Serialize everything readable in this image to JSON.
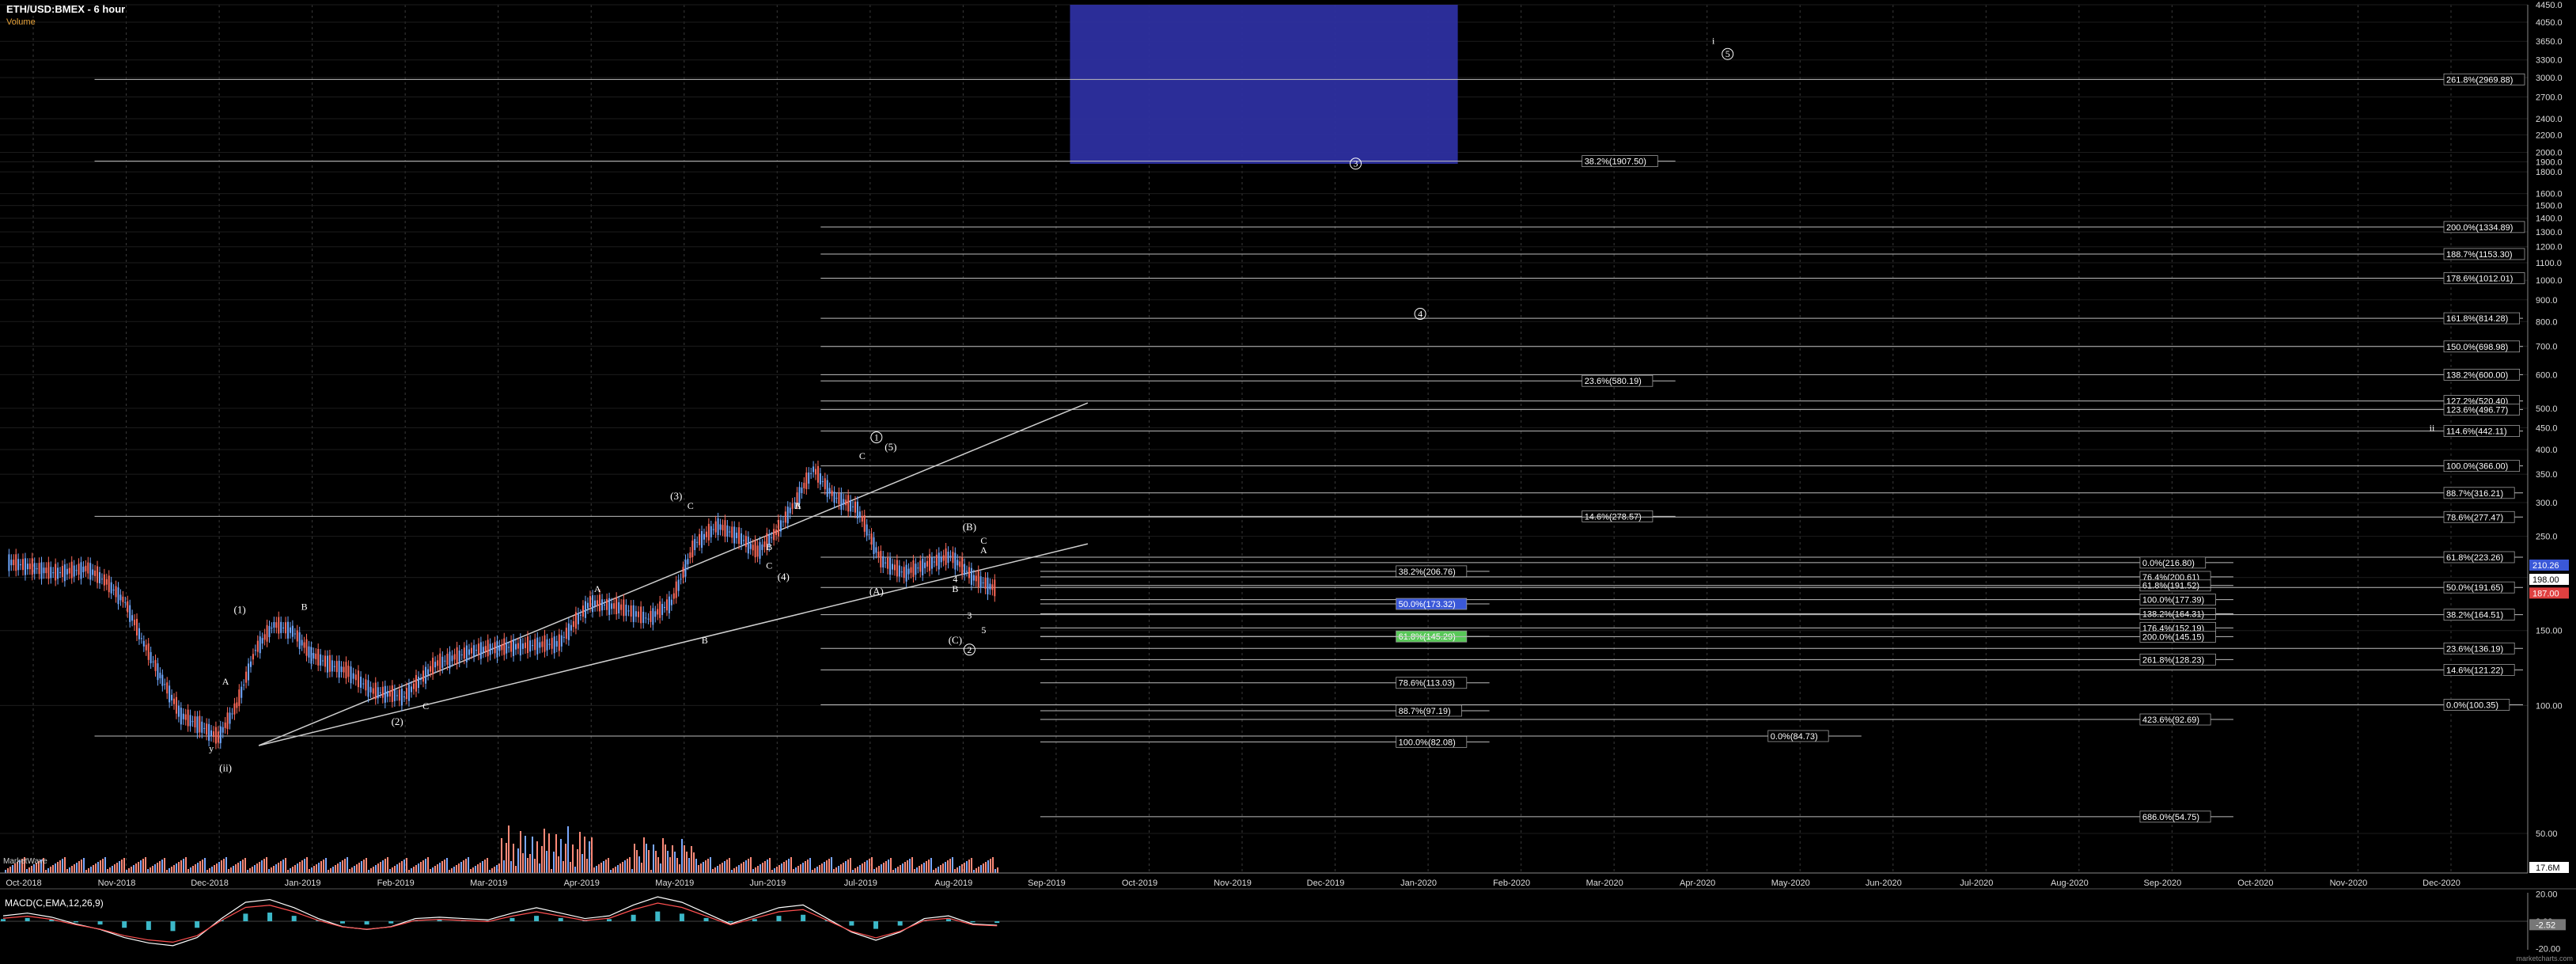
{
  "header": {
    "title": "ETH/USD:BMEX - 6 hour",
    "subtitle": "Volume",
    "macd_label": "MACD(C,EMA,12,26,9)",
    "watermark": "MarketWave",
    "footer_mark": "marketcharts.com"
  },
  "colors": {
    "background": "#000000",
    "grid": "#3a3a3a",
    "candle_up": "#6fa8ff",
    "candle_down": "#ff6a5a",
    "blue_box": "#2d2fa0",
    "lines": "#cfcfcf"
  },
  "chart_data": {
    "type": "candlestick",
    "y_scale": "log",
    "ylim": [
      50,
      4450
    ],
    "x_ticks": [
      "Oct-2018",
      "Nov-2018",
      "Dec-2018",
      "Jan-2019",
      "Feb-2019",
      "Mar-2019",
      "Apr-2019",
      "May-2019",
      "Jun-2019",
      "Jul-2019",
      "Aug-2019",
      "Sep-2019",
      "Oct-2019",
      "Nov-2019",
      "Dec-2019",
      "Jan-2020",
      "Feb-2020",
      "Mar-2020",
      "Apr-2020",
      "May-2020",
      "Jun-2020",
      "Jul-2020",
      "Aug-2020",
      "Sep-2020",
      "Oct-2020",
      "Nov-2020",
      "Dec-2020"
    ],
    "y_ticks": [
      50,
      100,
      150,
      200,
      250,
      300,
      350,
      400,
      450,
      500,
      600,
      700,
      800,
      900,
      1000,
      1100,
      1200,
      1300,
      1400,
      1500,
      1600,
      1800,
      1900,
      2000,
      2200,
      2400,
      2700,
      3000,
      3300,
      3650,
      4050,
      4450
    ],
    "y_tick_labels": [
      "50.00",
      "100.00",
      "150.00",
      "200.0",
      "250.0",
      "300.0",
      "350.0",
      "400.0",
      "450.0",
      "500.0",
      "600.0",
      "700.0",
      "800.0",
      "900.0",
      "1000.0",
      "1100.0",
      "1200.0",
      "1300.0",
      "1400.0",
      "1500.0",
      "1600.0",
      "1800.0",
      "1900.0",
      "2000.0",
      "2200.0",
      "2400.0",
      "2700.0",
      "3000.0",
      "3300.0",
      "3650.0",
      "4050.0",
      "4450.0"
    ],
    "price_path": [
      [
        "Oct-2018",
        218
      ],
      [
        "Oct-2018",
        205
      ],
      [
        "Nov-2018",
        210
      ],
      [
        "Nov-2018",
        195
      ],
      [
        "Nov-2018",
        175
      ],
      [
        "Nov-2018",
        140
      ],
      [
        "Nov-2018",
        115
      ],
      [
        "Dec-2018",
        95
      ],
      [
        "Dec-2018",
        90
      ],
      [
        "Dec-2018",
        84
      ],
      [
        "Dec-2018",
        100
      ],
      [
        "Dec-2018",
        135
      ],
      [
        "Jan-2019",
        155
      ],
      [
        "Jan-2019",
        150
      ],
      [
        "Jan-2019",
        132
      ],
      [
        "Jan-2019",
        125
      ],
      [
        "Jan-2019",
        120
      ],
      [
        "Feb-2019",
        108
      ],
      [
        "Feb-2019",
        105
      ],
      [
        "Feb-2019",
        125
      ],
      [
        "Mar-2019",
        135
      ],
      [
        "Mar-2019",
        138
      ],
      [
        "Apr-2019",
        140
      ],
      [
        "Apr-2019",
        175
      ],
      [
        "Apr-2019",
        170
      ],
      [
        "May-2019",
        160
      ],
      [
        "May-2019",
        175
      ],
      [
        "May-2019",
        240
      ],
      [
        "May-2019",
        265
      ],
      [
        "Jun-2019",
        250
      ],
      [
        "Jun-2019",
        230
      ],
      [
        "Jun-2019",
        255
      ],
      [
        "Jun-2019",
        300
      ],
      [
        "Jun-2019",
        360
      ],
      [
        "Jul-2019",
        310
      ],
      [
        "Jul-2019",
        290
      ],
      [
        "Jul-2019",
        220
      ],
      [
        "Jul-2019",
        205
      ],
      [
        "Aug-2019",
        215
      ],
      [
        "Aug-2019",
        225
      ],
      [
        "Aug-2019",
        200
      ],
      [
        "Aug-2019",
        187
      ]
    ],
    "last_price": "187.00",
    "current_price_labels": [
      {
        "text": "210.26",
        "value": 210.26,
        "color": "#3a58d8"
      },
      {
        "text": "198.00",
        "value": 198,
        "color": "#ffffff"
      },
      {
        "text": "187.00",
        "value": 187,
        "color": "#e04040"
      }
    ],
    "blue_box": {
      "x_from": "Oct-2019",
      "x_to": "Feb-2020",
      "y_from": 1880,
      "y_to": 4450
    },
    "channel_lines": [
      {
        "x1": "Dec-2018",
        "y1": 84,
        "x2": "Sep-2019",
        "y2": 515
      },
      {
        "x1": "Dec-2018",
        "y1": 84,
        "x2": "Sep-2019",
        "y2": 240
      }
    ],
    "fib_levels": [
      {
        "label": "261.8%(2969.88)",
        "value": 2969.88,
        "x_from": "Nov-2018",
        "x_to": "Dec-2020",
        "label_at": "right"
      },
      {
        "label": "38.2%(1907.50)",
        "value": 1907.5,
        "x_from": "Nov-2018",
        "x_to": "Feb-2020",
        "label_at": "Apr-2020"
      },
      {
        "label": "200.0%(1334.89)",
        "value": 1334.89,
        "x_from": "Jun-2019",
        "x_to": "Dec-2020",
        "label_at": "right"
      },
      {
        "label": "188.7%(1153.30)",
        "value": 1153.3,
        "x_from": "Jun-2019",
        "x_to": "Dec-2020",
        "label_at": "right"
      },
      {
        "label": "178.6%(1012.01)",
        "value": 1012.01,
        "x_from": "Jun-2019",
        "x_to": "Dec-2020",
        "label_at": "right"
      },
      {
        "label": "161.8%(814.28)",
        "value": 814.28,
        "x_from": "Jun-2019",
        "x_to": "Dec-2020",
        "label_at": "right"
      },
      {
        "label": "150.0%(698.98)",
        "value": 698.98,
        "x_from": "Jun-2019",
        "x_to": "Dec-2020",
        "label_at": "right"
      },
      {
        "label": "138.2%(600.00)",
        "value": 600,
        "x_from": "Jun-2019",
        "x_to": "Dec-2020",
        "label_at": "right"
      },
      {
        "label": "23.6%(580.19)",
        "value": 580.19,
        "x_from": "Jun-2019",
        "x_to": "Mar-2020",
        "label_at": "Apr-2020"
      },
      {
        "label": "127.2%(520.40)",
        "value": 520.4,
        "x_from": "Jun-2019",
        "x_to": "Dec-2020",
        "label_at": "right"
      },
      {
        "label": "123.6%(496.77)",
        "value": 496.77,
        "x_from": "Jun-2019",
        "x_to": "Dec-2020",
        "label_at": "right"
      },
      {
        "label": "114.6%(442.11)",
        "value": 442.11,
        "x_from": "Jun-2019",
        "x_to": "Dec-2020",
        "label_at": "right"
      },
      {
        "label": "100.0%(366.00)",
        "value": 366,
        "x_from": "Jun-2019",
        "x_to": "Dec-2020",
        "label_at": "right"
      },
      {
        "label": "88.7%(316.21)",
        "value": 316.21,
        "x_from": "Jun-2019",
        "x_to": "Dec-2020",
        "label_at": "right"
      },
      {
        "label": "14.6%(278.57)",
        "value": 278.57,
        "x_from": "Nov-2018",
        "x_to": "Mar-2020",
        "label_at": "Apr-2020"
      },
      {
        "label": "78.6%(277.47)",
        "value": 277.47,
        "x_from": "Jun-2019",
        "x_to": "Dec-2020",
        "label_at": "right"
      },
      {
        "label": "61.8%(223.26)",
        "value": 223.26,
        "x_from": "Jun-2019",
        "x_to": "Dec-2020",
        "label_at": "right"
      },
      {
        "label": "0.0%(216.80)",
        "value": 216.8,
        "x_from": "Sep-2019",
        "x_to": "Jul-2020",
        "label_at": "Oct-2020"
      },
      {
        "label": "38.2%(206.76)",
        "value": 206.76,
        "x_from": "Sep-2019",
        "x_to": "Jan-2020",
        "label_at": "Feb-2020"
      },
      {
        "label": "76.4%(200.61)",
        "value": 200.61,
        "x_from": "Sep-2019",
        "x_to": "Jul-2020",
        "label_at": "Oct-2020"
      },
      {
        "label": "61.8%(191.52)",
        "value": 191.52,
        "x_from": "Sep-2019",
        "x_to": "Jul-2020",
        "label_at": "Oct-2020"
      },
      {
        "label": "50.0%(191.65)",
        "value": 189.5,
        "x_from": "Jun-2019",
        "x_to": "Dec-2020",
        "label_at": "right"
      },
      {
        "label": "100.0%(177.39)",
        "value": 177.39,
        "x_from": "Sep-2019",
        "x_to": "Jul-2020",
        "label_at": "Oct-2020"
      },
      {
        "label": "50.0%(173.32)",
        "value": 173.32,
        "x_from": "Sep-2019",
        "x_to": "Jan-2020",
        "label_at": "Feb-2020",
        "box": "#3a58d8"
      },
      {
        "label": "138.2%(164.31)",
        "value": 164.31,
        "x_from": "Sep-2019",
        "x_to": "Jul-2020",
        "label_at": "Oct-2020"
      },
      {
        "label": "38.2%(164.51)",
        "value": 163.5,
        "x_from": "Jun-2019",
        "x_to": "Dec-2020",
        "label_at": "right"
      },
      {
        "label": "176.4%(152.19)",
        "value": 152.19,
        "x_from": "Sep-2019",
        "x_to": "Jul-2020",
        "label_at": "Oct-2020"
      },
      {
        "label": "61.8%(145.29)",
        "value": 145.29,
        "x_from": "Sep-2019",
        "x_to": "Jan-2020",
        "label_at": "Feb-2020",
        "box": "#58c858"
      },
      {
        "label": "200.0%(145.15)",
        "value": 145.15,
        "x_from": "Sep-2019",
        "x_to": "Jul-2020",
        "label_at": "Oct-2020"
      },
      {
        "label": "23.6%(136.19)",
        "value": 136.19,
        "x_from": "Jun-2019",
        "x_to": "Dec-2020",
        "label_at": "right"
      },
      {
        "label": "261.8%(128.23)",
        "value": 128.23,
        "x_from": "Sep-2019",
        "x_to": "Jul-2020",
        "label_at": "Oct-2020"
      },
      {
        "label": "14.6%(121.22)",
        "value": 121.22,
        "x_from": "Jun-2019",
        "x_to": "Dec-2020",
        "label_at": "right"
      },
      {
        "label": "78.6%(113.03)",
        "value": 113.03,
        "x_from": "Sep-2019",
        "x_to": "Jan-2020",
        "label_at": "Feb-2020"
      },
      {
        "label": "0.0%(100.35)",
        "value": 100.35,
        "x_from": "Jun-2019",
        "x_to": "Dec-2020",
        "label_at": "right"
      },
      {
        "label": "88.7%(97.19)",
        "value": 97.19,
        "x_from": "Sep-2019",
        "x_to": "Jan-2020",
        "label_at": "Feb-2020"
      },
      {
        "label": "423.6%(92.69)",
        "value": 92.69,
        "x_from": "Sep-2019",
        "x_to": "Jul-2020",
        "label_at": "Oct-2020"
      },
      {
        "label": "0.0%(84.73)",
        "value": 84.73,
        "x_from": "Nov-2018",
        "x_to": "Apr-2020",
        "label_at": "Jun-2020"
      },
      {
        "label": "100.0%(82.08)",
        "value": 82.08,
        "x_from": "Sep-2019",
        "x_to": "Jan-2020",
        "label_at": "Feb-2020"
      },
      {
        "label": "686.0%(54.75)",
        "value": 54.75,
        "x_from": "Sep-2019",
        "x_to": "Jul-2020",
        "label_at": "Oct-2020"
      }
    ],
    "wave_labels": [
      {
        "text": "y",
        "x": "Dec-2018",
        "y": 78
      },
      {
        "text": "(ii)",
        "x": "Dec-2018",
        "y": 70
      },
      {
        "text": "(1)",
        "x": "Dec-2018",
        "y": 165
      },
      {
        "text": "B",
        "x": "Jan-2019",
        "y": 168
      },
      {
        "text": "A",
        "x": "Dec-2018",
        "y": 112
      },
      {
        "text": "C",
        "x": "Feb-2019",
        "y": 98
      },
      {
        "text": "(2)",
        "x": "Feb-2019",
        "y": 90
      },
      {
        "text": "A",
        "x": "Apr-2019",
        "y": 185
      },
      {
        "text": "B",
        "x": "May-2019",
        "y": 140
      },
      {
        "text": "(3)",
        "x": "May-2019",
        "y": 305
      },
      {
        "text": "C",
        "x": "May-2019",
        "y": 290
      },
      {
        "text": "B",
        "x": "Jun-2019",
        "y": 290
      },
      {
        "text": "C",
        "x": "Jun-2019",
        "y": 210
      },
      {
        "text": "(4)",
        "x": "Jun-2019",
        "y": 197
      },
      {
        "text": "A",
        "x": "Jun-2019",
        "y": 290
      },
      {
        "text": "B",
        "x": "Jun-2019",
        "y": 232
      },
      {
        "text": "1",
        "x": "Jul-2019",
        "y": 420,
        "circled": true
      },
      {
        "text": "(5)",
        "x": "Jul-2019",
        "y": 398
      },
      {
        "text": "C",
        "x": "Jul-2019",
        "y": 380
      },
      {
        "text": "(A)",
        "x": "Jul-2019",
        "y": 182
      },
      {
        "text": "A",
        "x": "Aug-2019",
        "y": 228
      },
      {
        "text": "B",
        "x": "Aug-2019",
        "y": 185
      },
      {
        "text": "(B)",
        "x": "Aug-2019",
        "y": 258
      },
      {
        "text": "C",
        "x": "Aug-2019",
        "y": 240
      },
      {
        "text": "4",
        "x": "Aug-2019",
        "y": 195
      },
      {
        "text": "3",
        "x": "Aug-2019",
        "y": 160
      },
      {
        "text": "5",
        "x": "Aug-2019",
        "y": 148
      },
      {
        "text": "(C)",
        "x": "Aug-2019",
        "y": 140
      },
      {
        "text": "2",
        "x": "Aug-2019",
        "y": 133,
        "circled": true
      },
      {
        "text": "3",
        "x": "Dec-2019",
        "y": 1850,
        "circled": true
      },
      {
        "text": "4",
        "x": "Jan-2020",
        "y": 820,
        "circled": true
      },
      {
        "text": "i",
        "x": "Apr-2020",
        "y": 3600
      },
      {
        "text": "5",
        "x": "Apr-2020",
        "y": 3350,
        "circled": true
      },
      {
        "text": "ii",
        "x": "Dec-2020",
        "y": 442
      }
    ],
    "volume_max_label": "17.6M",
    "macd_ylim": [
      -21,
      21
    ],
    "macd_ticks": [
      -20,
      0,
      20
    ],
    "macd_tick_labels": [
      "-20.00",
      "0.00",
      "20.00"
    ],
    "macd_last_label": "-2.52",
    "macd_values": [
      4,
      6,
      3,
      -2,
      -6,
      -12,
      -16,
      -18,
      -12,
      2,
      14,
      16,
      10,
      2,
      -4,
      -6,
      -4,
      2,
      3,
      2,
      1,
      6,
      10,
      6,
      2,
      4,
      12,
      18,
      14,
      6,
      -2,
      4,
      10,
      12,
      2,
      -8,
      -14,
      -8,
      2,
      4,
      -2,
      -3
    ]
  }
}
